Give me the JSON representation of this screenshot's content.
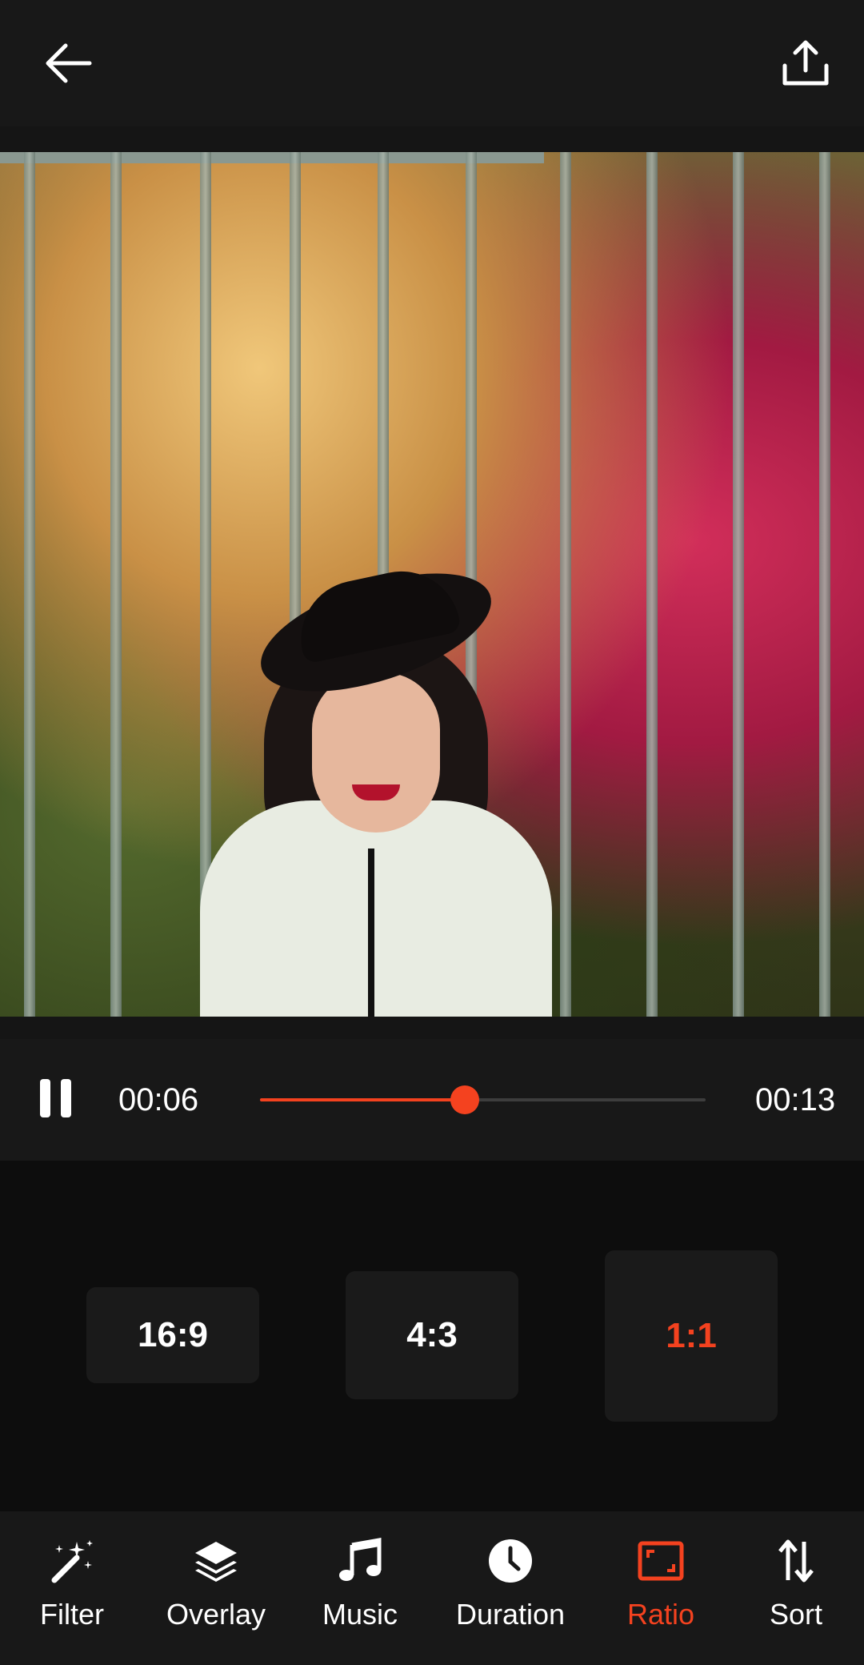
{
  "colors": {
    "accent": "#f4421f",
    "bar_bg": "#181818",
    "page_bg": "#0d0d0d",
    "button_bg": "#1a1a1a"
  },
  "header": {
    "back_icon": "arrow-left-icon",
    "share_icon": "upload-icon"
  },
  "player": {
    "state_icon": "pause-icon",
    "current_time": "00:06",
    "total_time": "00:13",
    "progress": 0.46
  },
  "ratios": {
    "options": [
      {
        "label": "16:9",
        "selected": false
      },
      {
        "label": "4:3",
        "selected": false
      },
      {
        "label": "1:1",
        "selected": true
      }
    ]
  },
  "nav": {
    "items": [
      {
        "label": "Filter",
        "icon": "magic-wand-icon",
        "active": false
      },
      {
        "label": "Overlay",
        "icon": "layers-icon",
        "active": false
      },
      {
        "label": "Music",
        "icon": "music-note-icon",
        "active": false
      },
      {
        "label": "Duration",
        "icon": "clock-icon",
        "active": false
      },
      {
        "label": "Ratio",
        "icon": "aspect-ratio-icon",
        "active": true
      },
      {
        "label": "Sort",
        "icon": "sort-arrows-icon",
        "active": false
      }
    ]
  }
}
